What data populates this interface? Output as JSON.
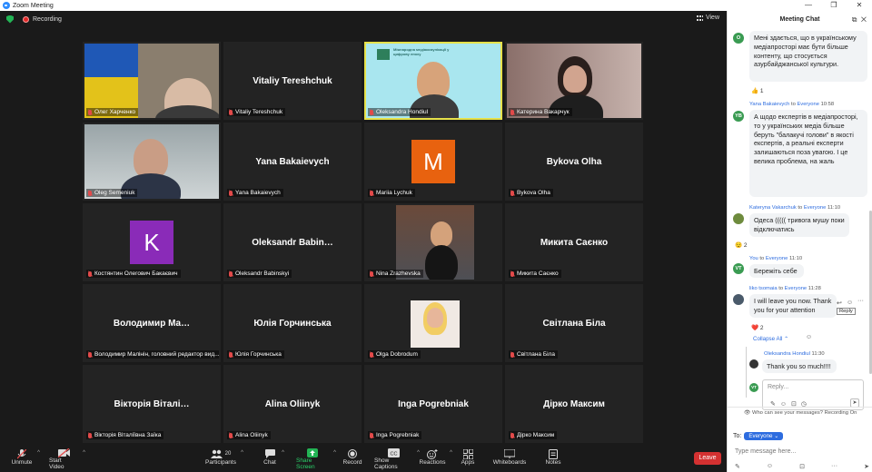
{
  "window": {
    "title": "Zoom Meeting"
  },
  "top_strip": {
    "recording_label": "Recording",
    "view_label": "View"
  },
  "participants_grid": [
    {
      "display": "video",
      "photo": "flag",
      "label": "Олег Харченко"
    },
    {
      "display": "name",
      "big": "Vitaliy Tereshchuk",
      "label": "Vitaliy Tereshchuk"
    },
    {
      "display": "video",
      "photo": "speaker",
      "label": "Oleksandra Hondiul",
      "active": true,
      "banner_text": "Міжнародна медіакомунікації у цифрову епоху"
    },
    {
      "display": "video",
      "photo": "room",
      "label": "Катерина Вакарчук"
    },
    {
      "display": "video",
      "photo": "man",
      "label": "Oleg Semeniuk"
    },
    {
      "display": "name",
      "big": "Yana Bakaievych",
      "label": "Yana Bakaievych"
    },
    {
      "display": "avatar",
      "letter": "M",
      "color": "#e8620f",
      "label": "Mariia Lychuk"
    },
    {
      "display": "name",
      "big": "Bykova Olha",
      "label": "Bykova Olha"
    },
    {
      "display": "avatar",
      "letter": "K",
      "color": "#8a2bb8",
      "label": "Костянтин Олегович Бакаєвич"
    },
    {
      "display": "name",
      "big": "Oleksandr  Babin…",
      "label": "Oleksandr Babinskyi"
    },
    {
      "display": "video",
      "photo": "street",
      "label": "Nina Zrazhevska"
    },
    {
      "display": "name",
      "big": "Микита Саєнко",
      "label": "Микита Саєнко"
    },
    {
      "display": "name",
      "big": "Володимир  Ма…",
      "label": "Володимир Малінін, головний редактор вид..."
    },
    {
      "display": "name",
      "big": "Юлія Горчинська",
      "label": "Юлія Горчинська"
    },
    {
      "display": "video",
      "photo": "blonde",
      "label": "Olga Dobrodum"
    },
    {
      "display": "name",
      "big": "Світлана Біла",
      "label": "Світлана Біла"
    },
    {
      "display": "name",
      "big": "Вікторія Віталі…",
      "label": "Вікторія Віталіївна Заїка"
    },
    {
      "display": "name",
      "big": "Alina Oliinyk",
      "label": "Alina Oliinyk"
    },
    {
      "display": "name",
      "big": "Inga Pogrebniak",
      "label": "Inga Pogrebniak"
    },
    {
      "display": "name",
      "big": "Дірко Максим",
      "label": "Дірко Максим"
    }
  ],
  "toolbar": {
    "unmute": "Unmute",
    "start_video": "Start Video",
    "participants": "Participants",
    "participants_count": "20",
    "chat": "Chat",
    "share_screen": "Share Screen",
    "record": "Record",
    "captions": "Show Captions",
    "reactions": "Reactions",
    "apps": "Apps",
    "whiteboards": "Whiteboards",
    "notes": "Notes",
    "leave": "Leave"
  },
  "chat": {
    "header": "Meeting Chat",
    "messages": [
      {
        "avatar": "O",
        "avatar_color": "#3a9b52",
        "text": "Мені здається, що в українському медіапросторі має бути більше контенту, що стосується азурбайджанської культури.",
        "reaction": "👍 1"
      },
      {
        "avatar": "YB",
        "avatar_color": "#3a9b52",
        "sender": "Yana Bakaievych",
        "to": "Everyone",
        "time": "10:58",
        "text": "А щодо експертів в медіапросторі, то у українських медіа більше беруть \"балакучі голови\" в якості експертів, а реальні експерти залишаються поза увагою. І це велика проблема, на жаль"
      },
      {
        "avatar": "",
        "avatar_color": "#6e8b3d",
        "sender": "Kateryna Vakarchuk",
        "to": "Everyone",
        "time": "11:10",
        "text": "Одеса ((((( тривога мушу поки відключатись",
        "reaction": "😟 2"
      },
      {
        "avatar": "VT",
        "avatar_color": "#3a9b52",
        "sender": "You",
        "to": "Everyone",
        "time": "11:10",
        "text": "Бережіть себе"
      },
      {
        "avatar": "",
        "avatar_color": "#4a5a6a",
        "sender": "liko tsomaia",
        "to": "Everyone",
        "time": "11:28",
        "text": "I will leave you now. Thank you for your  attention",
        "reaction": "❤️ 2"
      }
    ],
    "collapse_label": "Collapse All",
    "reply_tooltip": "Reply",
    "thread_reply": {
      "sender": "Oleksandra Hondiul",
      "time": "11:30",
      "text": "Thank you so much!!!!"
    },
    "reply_placeholder": "Reply...",
    "reply_avatar": "VT",
    "privacy_note": "Who can see your messages? Recording On",
    "to_label": "To:",
    "to_value": "Everyone",
    "input_placeholder": "Type message here..."
  }
}
